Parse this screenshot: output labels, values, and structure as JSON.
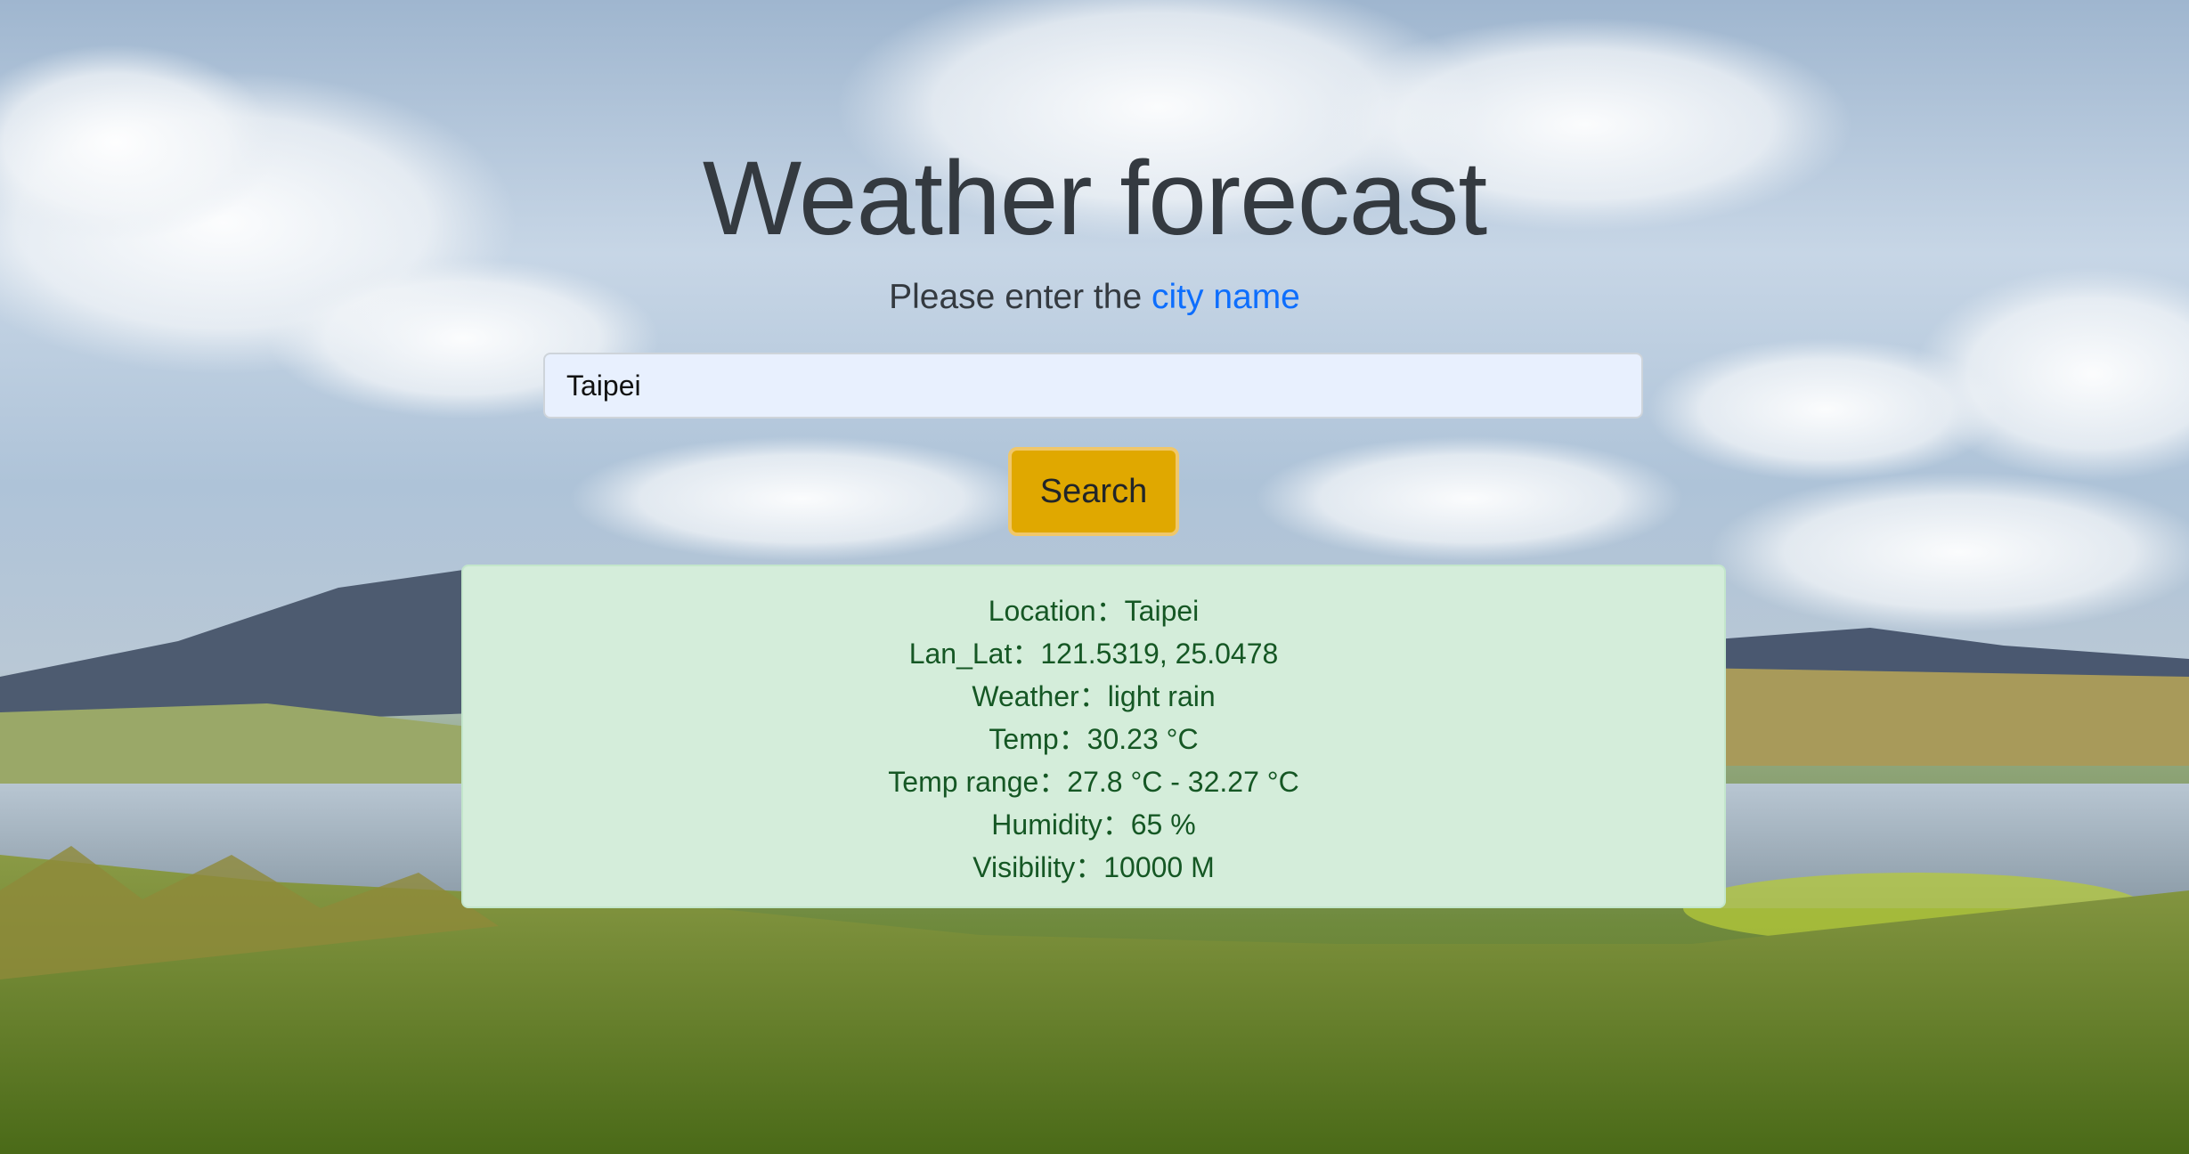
{
  "header": {
    "title": "Weather forecast",
    "prompt_prefix": "Please enter the ",
    "prompt_highlight": "city name"
  },
  "search": {
    "value": "Taipei",
    "button_label": "Search"
  },
  "result": {
    "lines": [
      "Location：Taipei",
      "Lan_Lat：121.5319, 25.0478",
      "Weather：light rain",
      "Temp：30.23 °C",
      "Temp range：27.8 °C - 32.27 °C",
      "Humidity：65 %",
      "Visibility：10000 M"
    ]
  },
  "colors": {
    "title_text": "#343a40",
    "highlight": "#0d6efd",
    "input_bg": "#e8f0fe",
    "button_bg": "#e0a800",
    "result_bg": "#d4edda",
    "result_text": "#155724"
  }
}
